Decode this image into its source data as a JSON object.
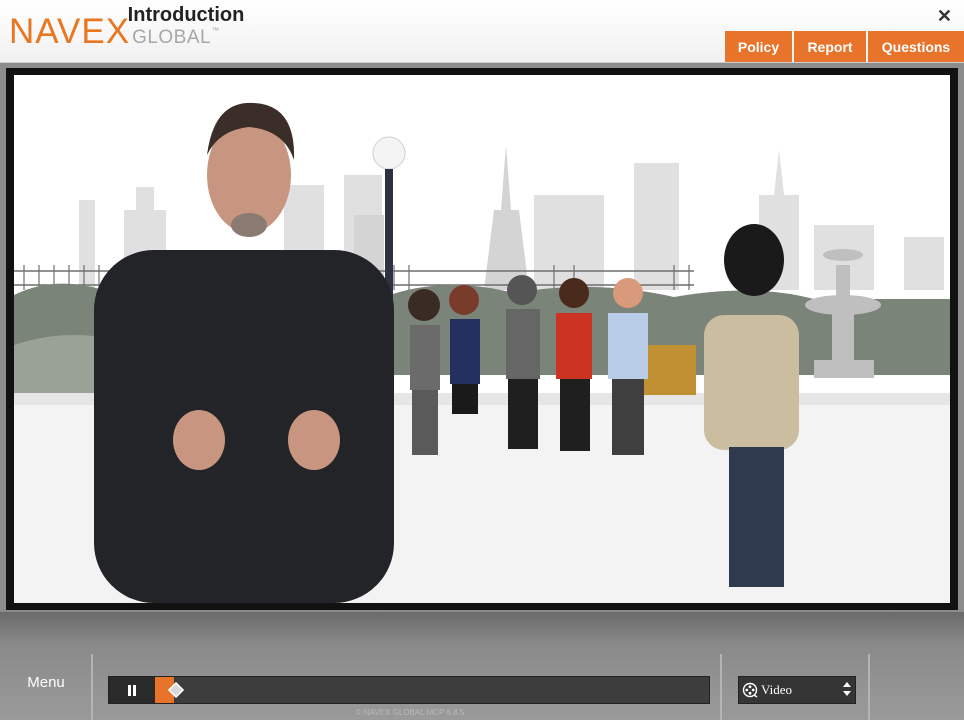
{
  "header": {
    "logo_main": "NAVEX",
    "logo_sub": "GLOBAL",
    "logo_tm": "™",
    "title": "Introduction",
    "close_glyph": "✕",
    "tabs": [
      {
        "label": "Policy"
      },
      {
        "label": "Report"
      },
      {
        "label": "Questions"
      }
    ],
    "accent_color": "#e8732a"
  },
  "player": {
    "menu_label": "Menu",
    "pause_icon": "pause-icon",
    "progress_fraction": 0.035,
    "mode_select": {
      "selected": "Video",
      "icon": "film-reel-icon"
    },
    "footer": "© NAVEX GLOBAL MCP 6.8.5"
  }
}
